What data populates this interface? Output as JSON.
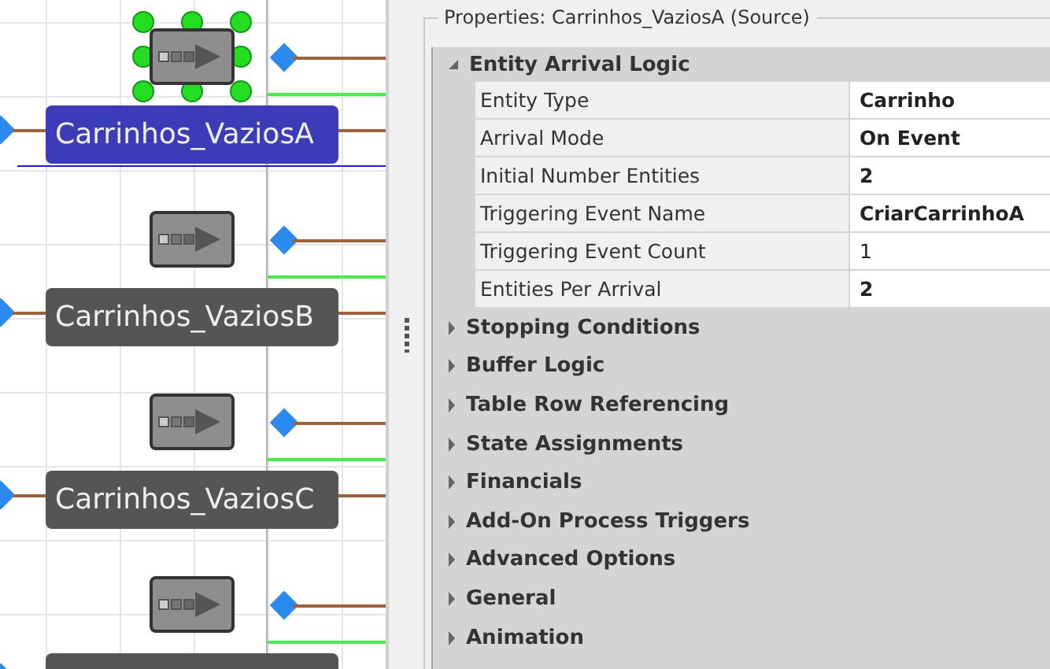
{
  "canvas": {
    "sources": [
      {
        "label": "Carrinhos_VaziosA",
        "selected": true
      },
      {
        "label": "Carrinhos_VaziosB",
        "selected": false
      },
      {
        "label": "Carrinhos_VaziosC",
        "selected": false
      },
      {
        "selected": false
      }
    ]
  },
  "properties": {
    "title": "Properties: Carrinhos_VaziosA (Source)",
    "groups": [
      {
        "label": "Entity Arrival Logic",
        "expanded": true,
        "rows": [
          {
            "name": "Entity Type",
            "value": "Carrinho",
            "modified": true
          },
          {
            "name": "Arrival Mode",
            "value": "On Event",
            "modified": true
          },
          {
            "name": "Initial Number Entities",
            "value": "2",
            "modified": true
          },
          {
            "name": "Triggering Event Name",
            "value": "CriarCarrinhoA",
            "modified": true
          },
          {
            "name": "Triggering Event Count",
            "value": "1",
            "modified": false
          },
          {
            "name": "Entities Per Arrival",
            "value": "2",
            "modified": true
          }
        ]
      },
      {
        "label": "Stopping Conditions",
        "expanded": false
      },
      {
        "label": "Buffer Logic",
        "expanded": false
      },
      {
        "label": "Table Row Referencing",
        "expanded": false
      },
      {
        "label": "State Assignments",
        "expanded": false
      },
      {
        "label": "Financials",
        "expanded": false
      },
      {
        "label": "Add-On Process Triggers",
        "expanded": false
      },
      {
        "label": "Advanced Options",
        "expanded": false
      },
      {
        "label": "General",
        "expanded": false
      },
      {
        "label": "Animation",
        "expanded": false
      }
    ]
  }
}
